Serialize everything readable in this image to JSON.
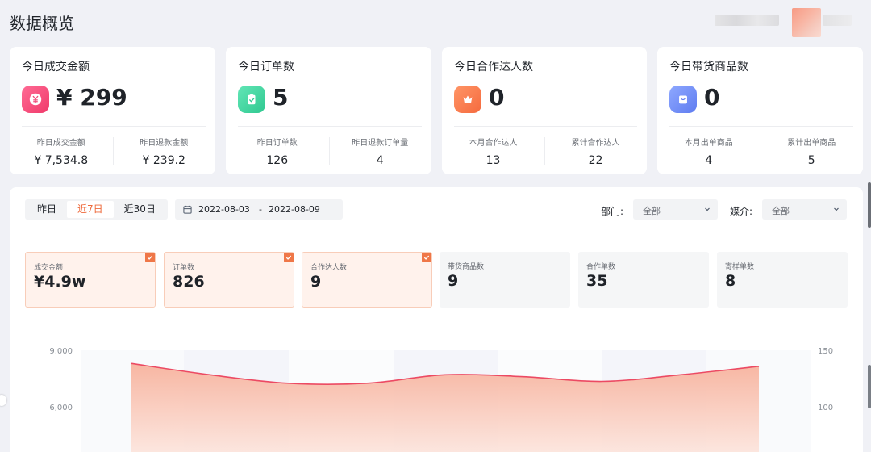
{
  "page": {
    "title": "数据概览"
  },
  "colors": {
    "accent": "#ee6a3c",
    "line": "#ec4a63"
  },
  "cards": [
    {
      "title": "今日成交金额",
      "value": "¥ 299",
      "icon": "yen-coin-icon",
      "icon_color": "#f54a7a",
      "sub": [
        {
          "label": "昨日成交金额",
          "value": "¥ 7,534.8"
        },
        {
          "label": "昨日退款金额",
          "value": "¥ 239.2"
        }
      ]
    },
    {
      "title": "今日订单数",
      "value": "5",
      "icon": "clipboard-check-icon",
      "icon_color": "#3fd5a0",
      "sub": [
        {
          "label": "昨日订单数",
          "value": "126"
        },
        {
          "label": "昨日退款订单量",
          "value": "4"
        }
      ]
    },
    {
      "title": "今日合作达人数",
      "value": "0",
      "icon": "crown-icon",
      "icon_color": "#ff7a50",
      "sub": [
        {
          "label": "本月合作达人",
          "value": "13"
        },
        {
          "label": "累计合作达人",
          "value": "22"
        }
      ]
    },
    {
      "title": "今日带货商品数",
      "value": "0",
      "icon": "shopping-bag-icon",
      "icon_color": "#6f8ef5",
      "sub": [
        {
          "label": "本月出单商品",
          "value": "4"
        },
        {
          "label": "累计出单商品",
          "value": "5"
        }
      ]
    }
  ],
  "filters": {
    "periods": [
      "昨日",
      "近7日",
      "近30日"
    ],
    "active_period": "近7日",
    "date_start": "2022-08-03",
    "date_sep": "-",
    "date_end": "2022-08-09",
    "dept_label": "部门:",
    "dept_value": "全部",
    "media_label": "媒介:",
    "media_value": "全部"
  },
  "metrics": [
    {
      "label": "成交金额",
      "value": "¥4.9w",
      "selected": true
    },
    {
      "label": "订单数",
      "value": "826",
      "selected": true
    },
    {
      "label": "合作达人数",
      "value": "9",
      "selected": true
    },
    {
      "label": "带货商品数",
      "value": "9",
      "selected": false
    },
    {
      "label": "合作单数",
      "value": "35",
      "selected": false
    },
    {
      "label": "寄样单数",
      "value": "8",
      "selected": false
    }
  ],
  "chart_data": {
    "type": "area",
    "left_ticks": [
      "9,000",
      "6,000"
    ],
    "right_ticks": [
      "150",
      "100"
    ],
    "series": [
      {
        "values": [
          8300,
          7700,
          7250,
          7250,
          7700,
          7600,
          7350,
          7700,
          8150
        ]
      }
    ]
  }
}
